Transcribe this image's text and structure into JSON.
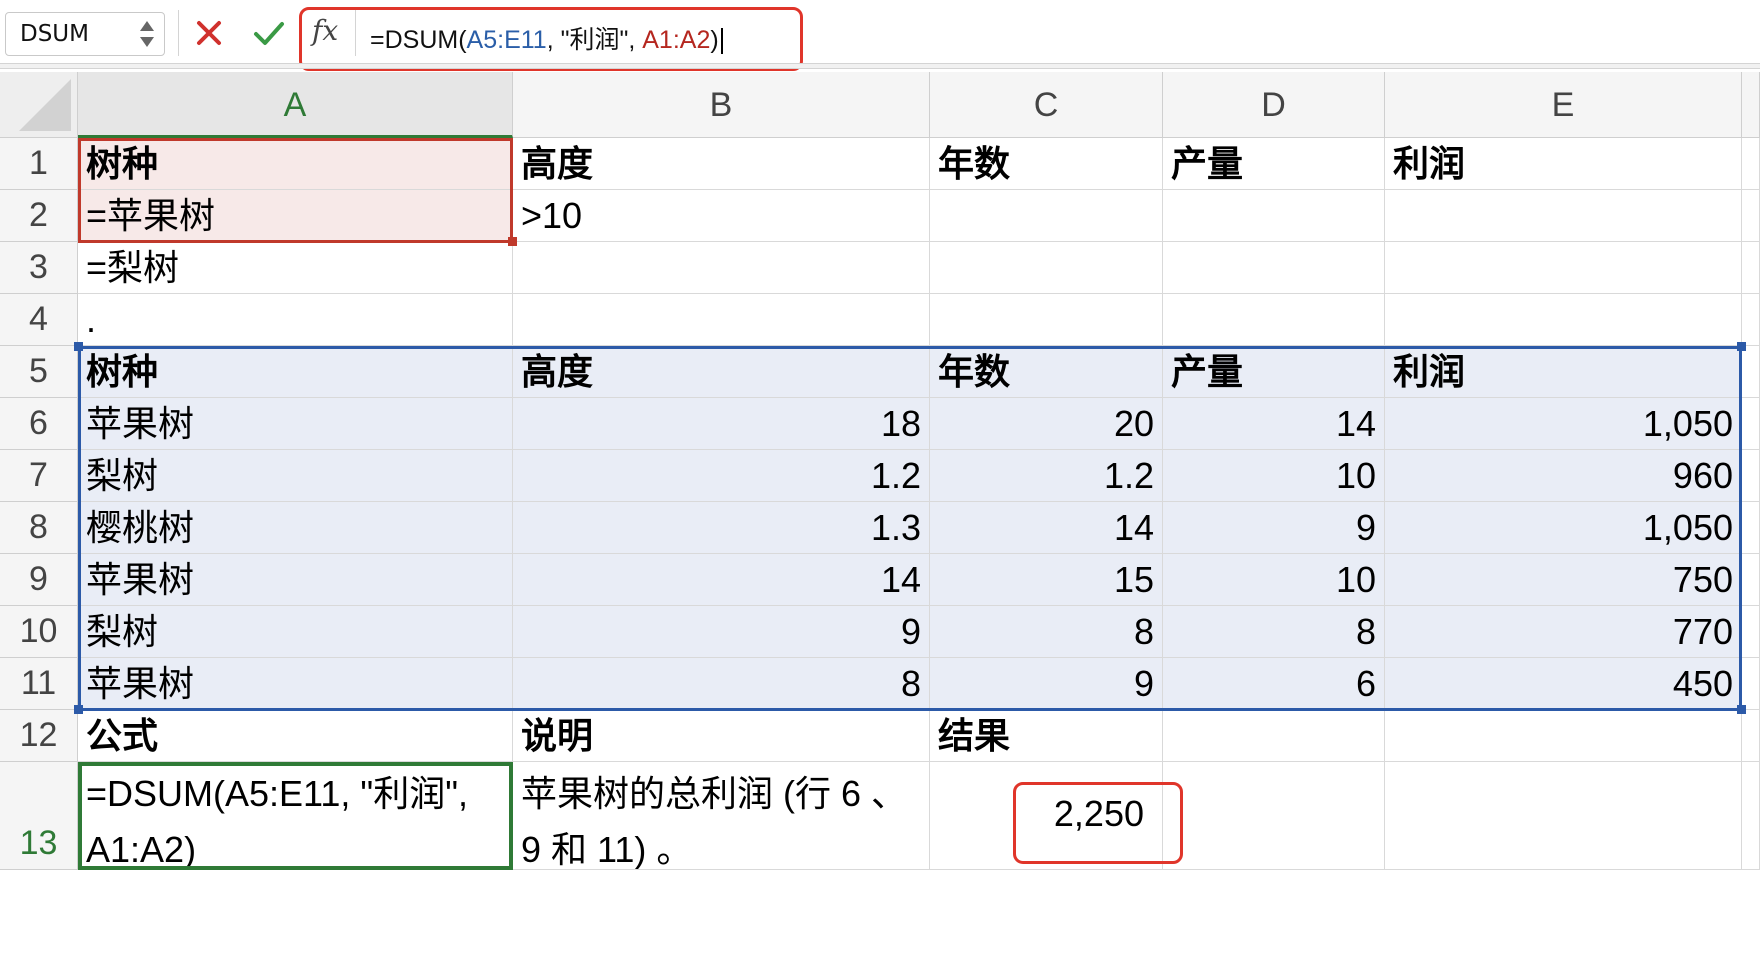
{
  "name_box": {
    "value": "DSUM"
  },
  "formula_bar": {
    "fx_label": "fx",
    "prefix": "=DSUM(",
    "ref1": "A5:E11",
    "middle": ", \"利润\", ",
    "ref2": "A1:A2",
    "suffix": ")"
  },
  "columns": [
    "A",
    "B",
    "C",
    "D",
    "E"
  ],
  "rows": [
    "1",
    "2",
    "3",
    "4",
    "5",
    "6",
    "7",
    "8",
    "9",
    "10",
    "11",
    "12",
    "13"
  ],
  "cells": {
    "A1": "树种",
    "B1": "高度",
    "C1": "年数",
    "D1": "产量",
    "E1": "利润",
    "A2": "=苹果树",
    "B2": ">10",
    "A3": "=梨树",
    "A4": ".",
    "A5": "树种",
    "B5": "高度",
    "C5": "年数",
    "D5": "产量",
    "E5": "利润",
    "A6": "苹果树",
    "B6": "18",
    "C6": "20",
    "D6": "14",
    "E6": "1,050",
    "A7": "梨树",
    "B7": "1.2",
    "C7": "1.2",
    "D7": "10",
    "E7": "960",
    "A8": "樱桃树",
    "B8": "1.3",
    "C8": "14",
    "D8": "9",
    "E8": "1,050",
    "A9": "苹果树",
    "B9": "14",
    "C9": "15",
    "D9": "10",
    "E9": "750",
    "A10": "梨树",
    "B10": "9",
    "C10": "8",
    "D10": "8",
    "E10": "770",
    "A11": "苹果树",
    "B11": "8",
    "C11": "9",
    "D11": "6",
    "E11": "450",
    "A12": "公式",
    "B12": "说明",
    "C12": "结果",
    "A13": "=DSUM(A5:E11, \"利润\", A1:A2)",
    "B13": "苹果树的总利润 (行 6 、9 和 11) 。",
    "C13": "2,250"
  },
  "colors": {
    "accent_green": "#2f7a36",
    "criteria_red": "#c0392b",
    "database_blue": "#2c5aa8",
    "callout_red": "#e0352a"
  }
}
